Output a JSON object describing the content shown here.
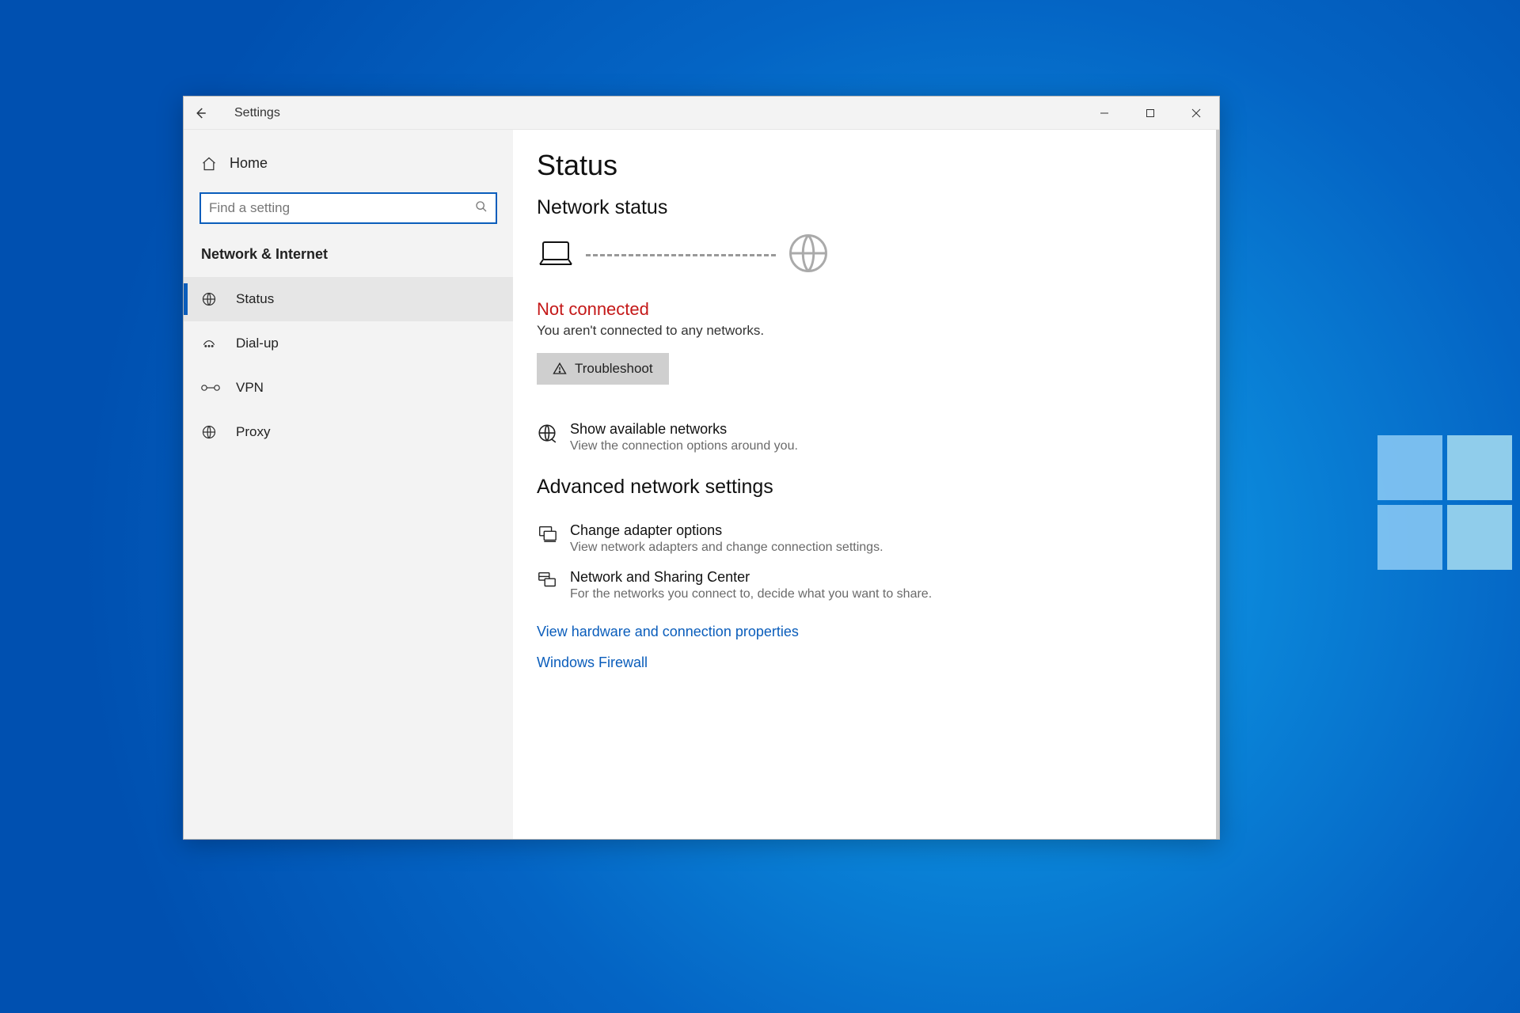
{
  "window": {
    "title": "Settings"
  },
  "sidebar": {
    "home": "Home",
    "search_placeholder": "Find a setting",
    "section": "Network & Internet",
    "items": [
      {
        "label": "Status"
      },
      {
        "label": "Dial-up"
      },
      {
        "label": "VPN"
      },
      {
        "label": "Proxy"
      }
    ]
  },
  "content": {
    "page_title": "Status",
    "network_status": "Network status",
    "not_connected": "Not connected",
    "not_connected_sub": "You aren't connected to any networks.",
    "troubleshoot": "Troubleshoot",
    "show_networks": {
      "title": "Show available networks",
      "desc": "View the connection options around you."
    },
    "advanced_header": "Advanced network settings",
    "adapter": {
      "title": "Change adapter options",
      "desc": "View network adapters and change connection settings."
    },
    "sharing": {
      "title": "Network and Sharing Center",
      "desc": "For the networks you connect to, decide what you want to share."
    },
    "link_hardware": "View hardware and connection properties",
    "link_firewall": "Windows Firewall"
  },
  "colors": {
    "accent": "#0a5dbb",
    "error": "#c41818"
  }
}
